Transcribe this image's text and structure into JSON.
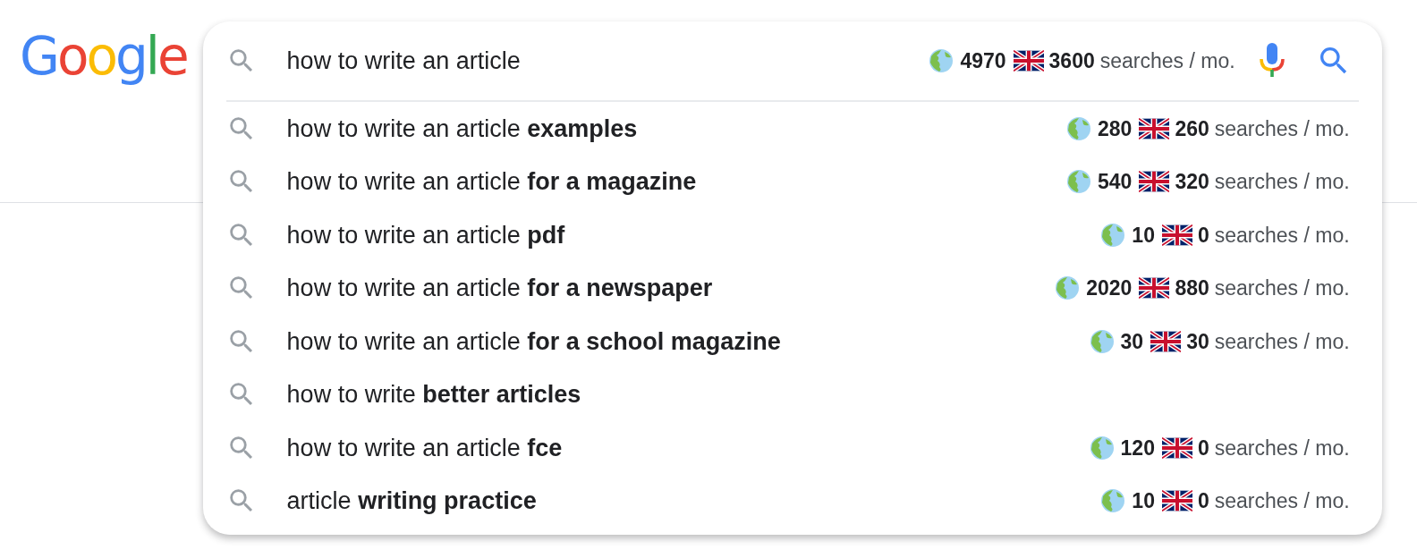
{
  "logo": {
    "text": "Google"
  },
  "search": {
    "value": "how to write an article",
    "stats": {
      "global": "4970",
      "uk": "3600",
      "unit": "searches / mo."
    }
  },
  "suggestions": [
    {
      "text": "how to write an article **examples**",
      "stats": {
        "global": "280",
        "uk": "260",
        "unit": "searches / mo."
      }
    },
    {
      "text": "how to write an article **for a magazine**",
      "stats": {
        "global": "540",
        "uk": "320",
        "unit": "searches / mo."
      }
    },
    {
      "text": "how to write an article **pdf**",
      "stats": {
        "global": "10",
        "uk": "0",
        "unit": "searches / mo."
      }
    },
    {
      "text": "how to write an article **for a newspaper**",
      "stats": {
        "global": "2020",
        "uk": "880",
        "unit": "searches / mo."
      }
    },
    {
      "text": "how to write an article **for a school magazine**",
      "stats": {
        "global": "30",
        "uk": "30",
        "unit": "searches / mo."
      }
    },
    {
      "text": "how to write **better articles**"
    },
    {
      "text": "how to write an article **fce**",
      "stats": {
        "global": "120",
        "uk": "0",
        "unit": "searches / mo."
      }
    },
    {
      "text": "article **writing practice**",
      "stats": {
        "global": "10",
        "uk": "0",
        "unit": "searches / mo."
      }
    }
  ]
}
